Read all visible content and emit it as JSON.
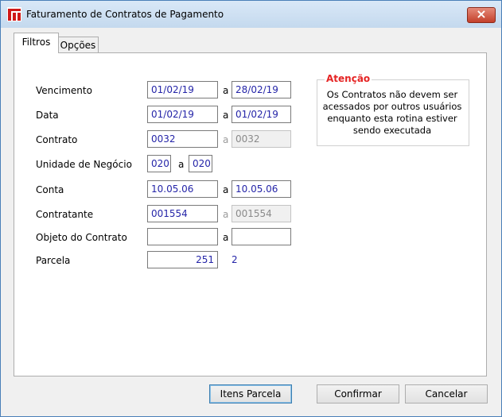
{
  "window": {
    "title": "Faturamento de Contratos de Pagamento"
  },
  "tabs": [
    {
      "label": "Filtros"
    },
    {
      "label": "Opções"
    }
  ],
  "fields": {
    "vencimento": {
      "label": "Vencimento",
      "from": "01/02/19",
      "sep": "a",
      "to": "28/02/19"
    },
    "data": {
      "label": "Data",
      "from": "01/02/19",
      "sep": "a",
      "to": "01/02/19"
    },
    "contrato": {
      "label": "Contrato",
      "from": "0032",
      "sep": "a",
      "to": "0032"
    },
    "unidade": {
      "label": "Unidade de Negócio",
      "from": "020",
      "sep": "a",
      "to": "020"
    },
    "conta": {
      "label": "Conta",
      "from": "10.05.06",
      "sep": "a",
      "to": "10.05.06"
    },
    "contratante": {
      "label": "Contratante",
      "from": "001554",
      "sep": "a",
      "to": "001554"
    },
    "objeto": {
      "label": "Objeto do Contrato",
      "from": "",
      "sep": "a",
      "to": ""
    },
    "parcela": {
      "label": "Parcela",
      "value": "251",
      "extra": "2"
    }
  },
  "attention": {
    "title": "Atenção",
    "text": "Os Contratos não devem ser acessados por outros usuários enquanto esta rotina estiver sendo executada"
  },
  "buttons": {
    "itens": "Itens Parcela",
    "confirmar": "Confirmar",
    "cancelar": "Cancelar"
  }
}
